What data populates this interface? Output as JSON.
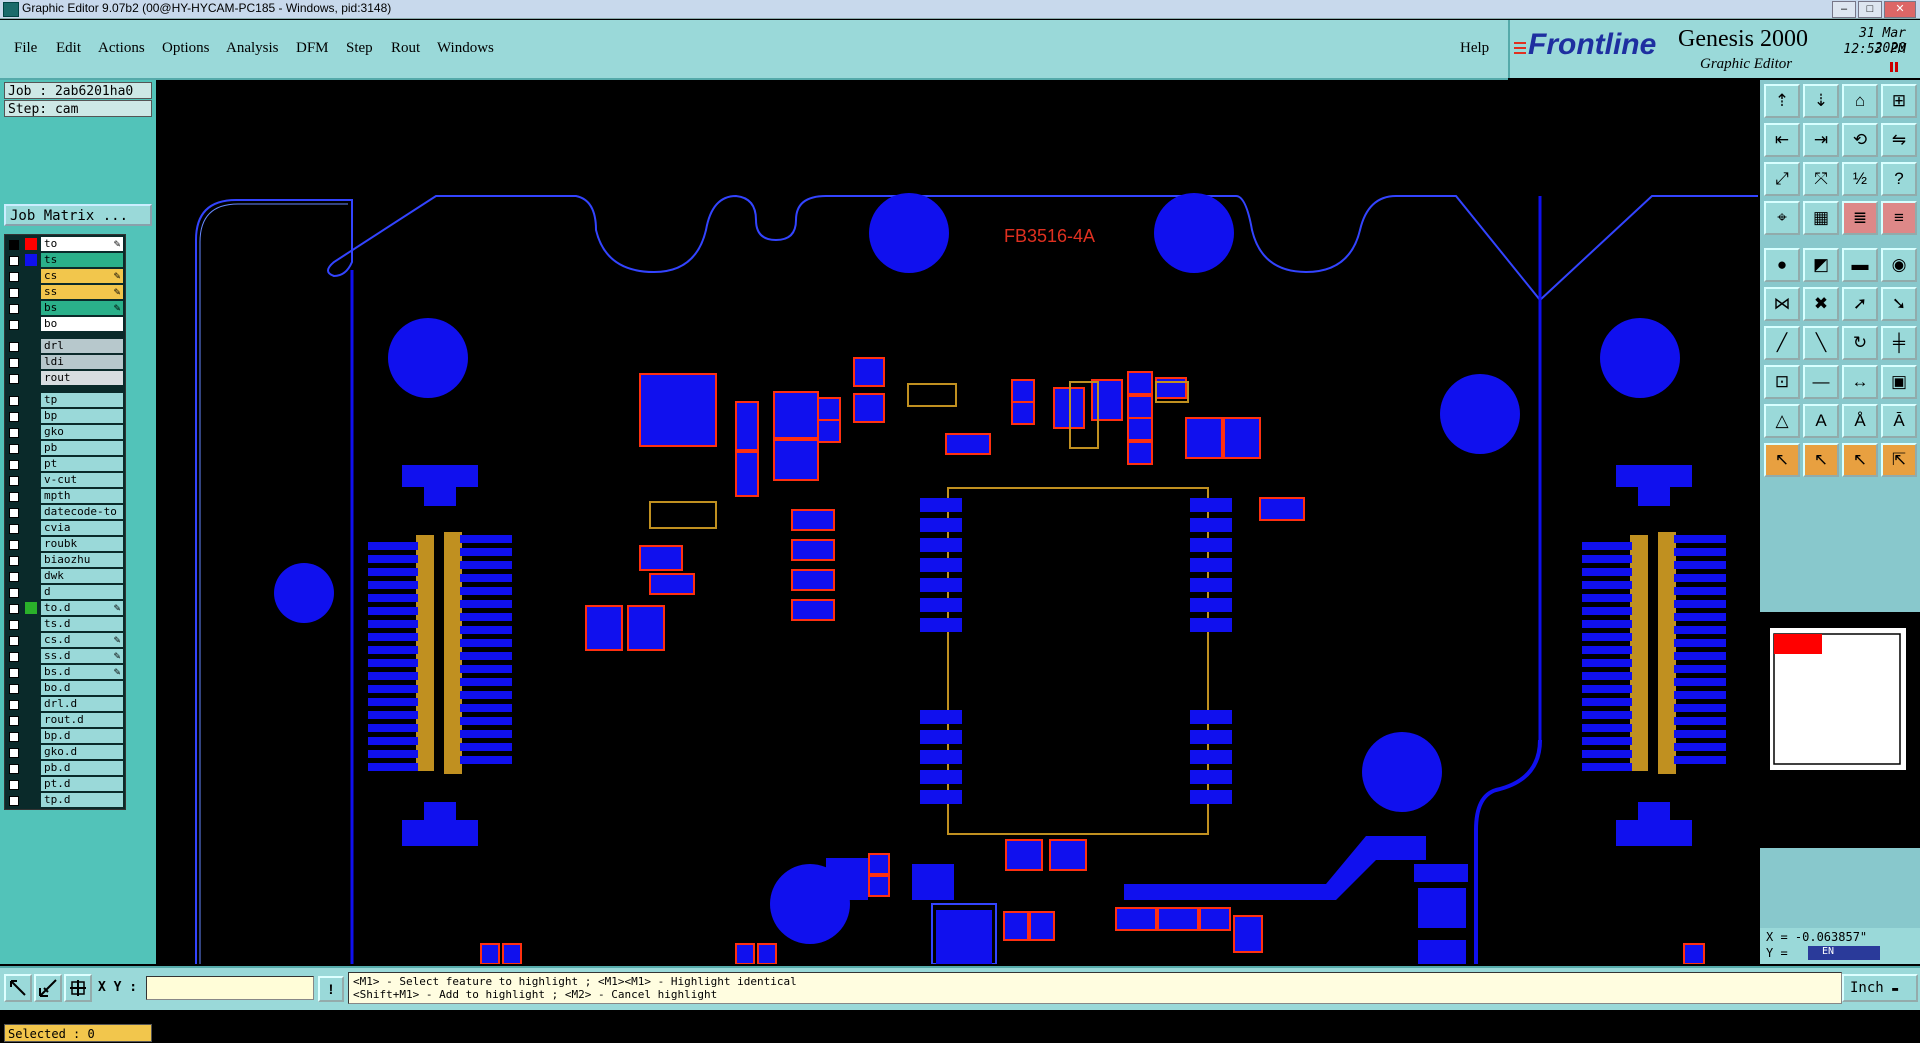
{
  "window": {
    "title": "Graphic Editor 9.07b2 (00@HY-HYCAM-PC185 - Windows, pid:3148)",
    "min": "–",
    "max": "□",
    "close": "✕"
  },
  "menu": {
    "items": [
      "File",
      "Edit",
      "Actions",
      "Options",
      "Analysis",
      "DFM",
      "Step",
      "Rout",
      "Windows"
    ],
    "help": "Help"
  },
  "brand": {
    "logo": "Frontline",
    "product": "Genesis 2000",
    "subtitle": "Graphic Editor",
    "date": "31 Mar 2020",
    "time": "12:53 PM"
  },
  "job": {
    "job_line": "Job : 2ab6201ha0",
    "step_line": "Step: cam",
    "matrix_button": "Job Matrix ..."
  },
  "layers": [
    {
      "name": "to",
      "color": "#ff0000",
      "bg": "#ffffff",
      "checked": true,
      "pen": true
    },
    {
      "name": "ts",
      "color": "#1010ee",
      "bg": "#2ab08a",
      "checked": false,
      "pen": false
    },
    {
      "name": "cs",
      "color": "",
      "bg": "#f2c64c",
      "checked": false,
      "pen": true
    },
    {
      "name": "ss",
      "color": "",
      "bg": "#f2c64c",
      "checked": false,
      "pen": true
    },
    {
      "name": "bs",
      "color": "",
      "bg": "#2ab08a",
      "checked": false,
      "pen": true
    },
    {
      "name": "bo",
      "color": "",
      "bg": "#ffffff",
      "checked": false,
      "pen": false
    },
    {
      "name": "drl",
      "color": "",
      "bg": "#b7c8cc",
      "checked": false,
      "pen": false,
      "gap": true
    },
    {
      "name": "ldi",
      "color": "",
      "bg": "#b7c8cc",
      "checked": false,
      "pen": false
    },
    {
      "name": "rout",
      "color": "",
      "bg": "#d8dde0",
      "checked": false,
      "pen": false
    },
    {
      "name": "tp",
      "color": "",
      "bg": "#9ad9d9",
      "checked": false,
      "pen": false,
      "gap": true
    },
    {
      "name": "bp",
      "color": "",
      "bg": "#9ad9d9",
      "checked": false,
      "pen": false
    },
    {
      "name": "gko",
      "color": "",
      "bg": "#9ad9d9",
      "checked": false,
      "pen": false
    },
    {
      "name": "pb",
      "color": "",
      "bg": "#9ad9d9",
      "checked": false,
      "pen": false
    },
    {
      "name": "pt",
      "color": "",
      "bg": "#9ad9d9",
      "checked": false,
      "pen": false
    },
    {
      "name": "v-cut",
      "color": "",
      "bg": "#9ad9d9",
      "checked": false,
      "pen": false
    },
    {
      "name": "mpth",
      "color": "",
      "bg": "#9ad9d9",
      "checked": false,
      "pen": false
    },
    {
      "name": "datecode-to",
      "color": "",
      "bg": "#9ad9d9",
      "checked": false,
      "pen": false
    },
    {
      "name": "cvia",
      "color": "",
      "bg": "#9ad9d9",
      "checked": false,
      "pen": false
    },
    {
      "name": "roubk",
      "color": "",
      "bg": "#9ad9d9",
      "checked": false,
      "pen": false
    },
    {
      "name": "biaozhu",
      "color": "",
      "bg": "#9ad9d9",
      "checked": false,
      "pen": false
    },
    {
      "name": "dwk",
      "color": "",
      "bg": "#9ad9d9",
      "checked": false,
      "pen": false
    },
    {
      "name": "d",
      "color": "",
      "bg": "#9ad9d9",
      "checked": false,
      "pen": false
    },
    {
      "name": "to.d",
      "color": "#2ab02a",
      "bg": "#9ad9d9",
      "checked": false,
      "pen": true
    },
    {
      "name": "ts.d",
      "color": "",
      "bg": "#9ad9d9",
      "checked": false,
      "pen": false
    },
    {
      "name": "cs.d",
      "color": "",
      "bg": "#9ad9d9",
      "checked": false,
      "pen": true
    },
    {
      "name": "ss.d",
      "color": "",
      "bg": "#9ad9d9",
      "checked": false,
      "pen": true
    },
    {
      "name": "bs.d",
      "color": "",
      "bg": "#9ad9d9",
      "checked": false,
      "pen": true
    },
    {
      "name": "bo.d",
      "color": "",
      "bg": "#9ad9d9",
      "checked": false,
      "pen": false
    },
    {
      "name": "drl.d",
      "color": "",
      "bg": "#9ad9d9",
      "checked": false,
      "pen": false
    },
    {
      "name": "rout.d",
      "color": "",
      "bg": "#9ad9d9",
      "checked": false,
      "pen": false
    },
    {
      "name": "bp.d",
      "color": "",
      "bg": "#9ad9d9",
      "checked": false,
      "pen": false
    },
    {
      "name": "gko.d",
      "color": "",
      "bg": "#9ad9d9",
      "checked": false,
      "pen": false
    },
    {
      "name": "pb.d",
      "color": "",
      "bg": "#9ad9d9",
      "checked": false,
      "pen": false
    },
    {
      "name": "pt.d",
      "color": "",
      "bg": "#9ad9d9",
      "checked": false,
      "pen": false
    },
    {
      "name": "tp.d",
      "color": "",
      "bg": "#9ad9d9",
      "checked": false,
      "pen": false
    }
  ],
  "status": {
    "selected": "Selected : 0"
  },
  "canvas": {
    "silkscreen_label": "FB3516-4A"
  },
  "toolbar": {
    "icons": [
      "open-job-icon",
      "save-icon",
      "home-icon",
      "window-split-icon",
      "prev-step-icon",
      "next-step-icon",
      "redraw-icon",
      "flip-icon",
      "zoom-fit-icon",
      "zoom-home-icon",
      "scale-1-2-icon",
      "help-query-icon",
      "snap-icon",
      "grid-icon",
      "layers-stack-icon",
      "layers-edit-icon",
      "add-pad-icon",
      "add-shape-icon",
      "add-surface-icon",
      "add-circle-icon",
      "connect-icon",
      "delete-feature-icon",
      "move-icon",
      "copy-icon",
      "line-icon",
      "arc-line-icon",
      "rotate-icon",
      "split-icon",
      "select-net-icon",
      "line-cut-icon",
      "measure-icon",
      "cover-icon",
      "triangle-add-icon",
      "text-a-icon",
      "text-outline-icon",
      "text-line-icon",
      "pointer-icon",
      "pointer-select-icon",
      "pointer-move-icon",
      "pointer-snap-icon"
    ]
  },
  "coords": {
    "x_line": "X = -0.063857\"",
    "y_line": "Y =",
    "lang": "EN"
  },
  "bottombar": {
    "xy_label": "X Y :",
    "message_line1": "<M1> - Select feature to highlight ; <M1><M1> - Highlight identical",
    "message_line2": "<Shift+M1> - Add to highlight ; <M2> - Cancel highlight",
    "units": "Inch"
  },
  "colors": {
    "copper": "#1010ee",
    "board_outline": "#3344ff",
    "pad_outline": "#ff3010",
    "silk": "#c09020",
    "panel": "#9ad9d9"
  }
}
